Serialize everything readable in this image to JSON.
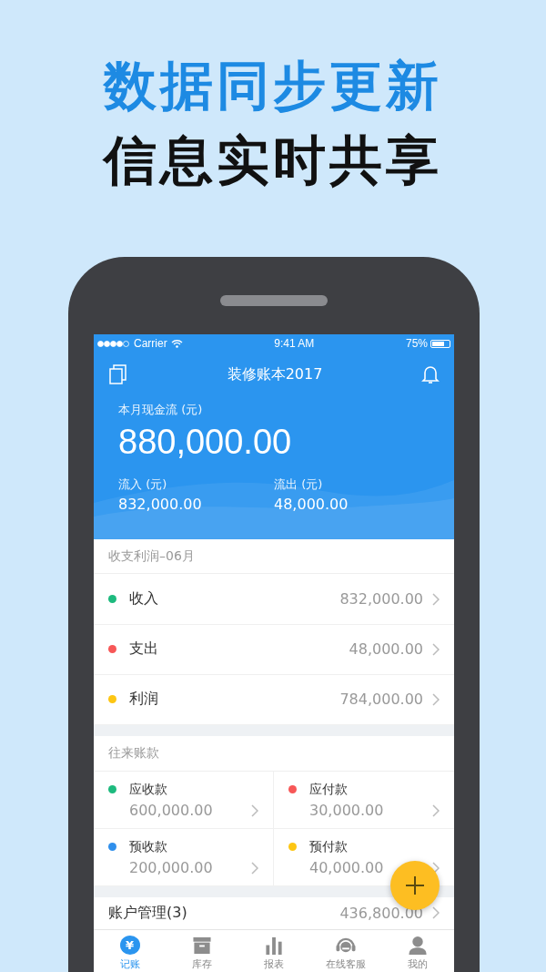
{
  "headline": [
    "数据同步更新",
    "信息实时共享"
  ],
  "status_bar": {
    "carrier": "Carrier",
    "time": "9:41 AM",
    "battery": "75%"
  },
  "nav": {
    "title": "装修账本2017"
  },
  "summary": {
    "label": "本月现金流 (元)",
    "amount": "880,000.00",
    "inflow_label": "流入 (元)",
    "inflow": "832,000.00",
    "outflow_label": "流出 (元)",
    "outflow": "48,000.00"
  },
  "profit": {
    "title": "收支利润–06月",
    "rows": [
      {
        "label": "收入",
        "value": "832,000.00",
        "color": "#1dba7e"
      },
      {
        "label": "支出",
        "value": "48,000.00",
        "color": "#f75757"
      },
      {
        "label": "利润",
        "value": "784,000.00",
        "color": "#fdc613"
      }
    ]
  },
  "accounts": {
    "title": "往来账款",
    "cells": [
      {
        "label": "应收款",
        "value": "600,000.00",
        "color": "#1dba7e"
      },
      {
        "label": "应付款",
        "value": "30,000.00",
        "color": "#f75757"
      },
      {
        "label": "预收款",
        "value": "200,000.00",
        "color": "#2f8fec"
      },
      {
        "label": "预付款",
        "value": "40,000.00",
        "color": "#fdc613"
      }
    ]
  },
  "account_management": {
    "label": "账户管理(3)",
    "value": "436,800.00"
  },
  "tabs": [
    {
      "label": "记账",
      "icon": "¥",
      "kind": "yen",
      "selected": true
    },
    {
      "label": "库存",
      "kind": "box",
      "selected": false
    },
    {
      "label": "报表",
      "kind": "chart",
      "selected": false
    },
    {
      "label": "在线客服",
      "kind": "headset",
      "selected": false
    },
    {
      "label": "我的",
      "kind": "person",
      "selected": false
    }
  ]
}
